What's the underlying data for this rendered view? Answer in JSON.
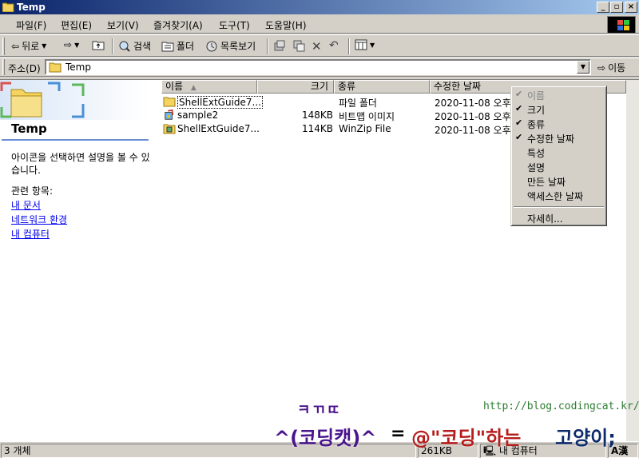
{
  "window": {
    "title": "Temp"
  },
  "menu": [
    "파일(F)",
    "편집(E)",
    "보기(V)",
    "즐겨찾기(A)",
    "도구(T)",
    "도움말(H)"
  ],
  "toolbar": {
    "back": "뒤로",
    "search": "검색",
    "folders": "폴더",
    "history": "목록보기"
  },
  "address": {
    "label": "주소(D)",
    "value": "Temp",
    "go": "이동"
  },
  "leftpane": {
    "title": "Temp",
    "description": "아이콘을 선택하면 설명을 볼 수 있습니다.",
    "related_label": "관련 항목:",
    "links": [
      "내 문서",
      "네트워크 환경",
      "내 컴퓨터"
    ]
  },
  "columns": {
    "name": "이름",
    "size": "크기",
    "type": "종류",
    "modified": "수정한 날짜"
  },
  "files": [
    {
      "name": "ShellExtGuide7...",
      "size": "",
      "type": "파일 폴더",
      "modified": "2020-11-08 오후 ...",
      "icon": "folder-icon"
    },
    {
      "name": "sample2",
      "size": "148KB",
      "type": "비트맵 이미지",
      "modified": "2020-11-08 오후 ...",
      "icon": "bitmap-icon"
    },
    {
      "name": "ShellExtGuide7...",
      "size": "114KB",
      "type": "WinZip File",
      "modified": "2020-11-08 오후 ...",
      "icon": "zip-icon"
    }
  ],
  "context_menu": {
    "items": [
      {
        "label": "이름",
        "checked": true,
        "disabled": true
      },
      {
        "label": "크기",
        "checked": true
      },
      {
        "label": "종류",
        "checked": true
      },
      {
        "label": "수정한 날짜",
        "checked": true
      },
      {
        "label": "특성",
        "checked": false
      },
      {
        "label": "설명",
        "checked": false
      },
      {
        "label": "만든 날짜",
        "checked": false
      },
      {
        "label": "액세스한 날짜",
        "checked": false
      }
    ],
    "more": "자세히..."
  },
  "status": {
    "count": "3 개체",
    "size": "261KB",
    "zone": "내 컴퓨터",
    "ime": "A漢"
  },
  "watermark": {
    "url": "http://blog.codingcat.kr/",
    "small": "ㅋㄲㄸ",
    "main_left": "^(코딩캣)^",
    "eq": "=",
    "main_mid": "@\"코딩\"하는",
    "main_right": "고양이;"
  }
}
